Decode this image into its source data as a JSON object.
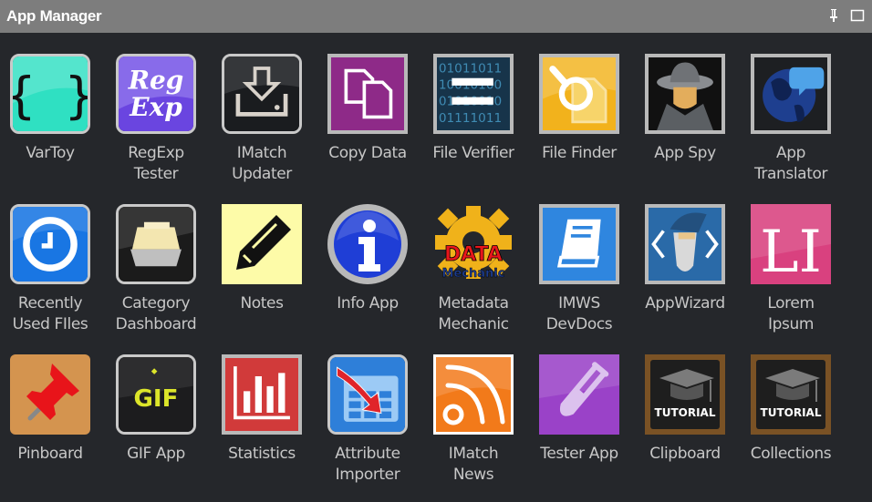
{
  "window": {
    "title": "App Manager",
    "pin_icon": "pin-icon",
    "maximize_icon": "maximize-icon"
  },
  "apps": [
    {
      "name": "VarToy",
      "lines": [
        "VarToy"
      ],
      "icon": "curly-braces-icon",
      "color": "#2fe0c2"
    },
    {
      "name": "RegExp Tester",
      "lines": [
        "RegExp",
        "Tester"
      ],
      "icon": "regexp-icon",
      "color": "#6a45e0",
      "icon_text": [
        "Reg",
        "Exp"
      ]
    },
    {
      "name": "IMatch Updater",
      "lines": [
        "IMatch",
        "Updater"
      ],
      "icon": "download-tray-icon",
      "color": "#1a1c1f"
    },
    {
      "name": "Copy Data",
      "lines": [
        "Copy Data"
      ],
      "icon": "copy-documents-icon",
      "color": "#8e2a88"
    },
    {
      "name": "File Verifier",
      "lines": [
        "File Verifier"
      ],
      "icon": "binary-equals-icon",
      "color": "#17344a",
      "icon_text": [
        "01011011",
        "10010100",
        "01010010",
        "01111011"
      ]
    },
    {
      "name": "File Finder",
      "lines": [
        "File Finder"
      ],
      "icon": "magnifier-file-icon",
      "color": "#f2b21c"
    },
    {
      "name": "App Spy",
      "lines": [
        "App Spy"
      ],
      "icon": "spy-icon",
      "color": "#111111"
    },
    {
      "name": "App Translator",
      "lines": [
        "App",
        "Translator"
      ],
      "icon": "globe-speech-icon",
      "color": "#1e3f8f"
    },
    {
      "name": "Recently Used FIles",
      "lines": [
        "Recently",
        "Used FIles"
      ],
      "icon": "clock-icon",
      "color": "#1976e3"
    },
    {
      "name": "Category Dashboard",
      "lines": [
        "Category",
        "Dashboard"
      ],
      "icon": "card-file-icon",
      "color": "#1b1b1b"
    },
    {
      "name": "Notes",
      "lines": [
        "Notes"
      ],
      "icon": "pencil-icon",
      "color": "#fdfba8"
    },
    {
      "name": "Info App",
      "lines": [
        "Info App"
      ],
      "icon": "info-icon",
      "color": "#1f3ed6"
    },
    {
      "name": "Metadata Mechanic",
      "lines": [
        "Metadata",
        "Mechanic"
      ],
      "icon": "gear-data-icon",
      "color": "#f0b21a",
      "icon_text": [
        "DATA",
        "Mechanic"
      ]
    },
    {
      "name": "IMWS DevDocs",
      "lines": [
        "IMWS",
        "DevDocs"
      ],
      "icon": "book-icon",
      "color": "#2f86df"
    },
    {
      "name": "AppWizard",
      "lines": [
        "AppWizard"
      ],
      "icon": "wizard-icon",
      "color": "#2a6aa8"
    },
    {
      "name": "Lorem Ipsum",
      "lines": [
        "Lorem",
        "Ipsum"
      ],
      "icon": "lorem-ipsum-icon",
      "color": "#d9417f",
      "icon_text": [
        "LI"
      ]
    },
    {
      "name": "Pinboard",
      "lines": [
        "Pinboard"
      ],
      "icon": "pushpin-icon",
      "color": "#d4944f"
    },
    {
      "name": "GIF App",
      "lines": [
        "GIF App"
      ],
      "icon": "gif-icon",
      "color": "#1c1c1e",
      "icon_text": [
        "GIF"
      ]
    },
    {
      "name": "Statistics",
      "lines": [
        "Statistics"
      ],
      "icon": "bar-chart-icon",
      "color": "#d13a3a"
    },
    {
      "name": "Attribute Importer",
      "lines": [
        "Attribute",
        "Importer"
      ],
      "icon": "table-import-icon",
      "color": "#2e7fd9"
    },
    {
      "name": "IMatch News",
      "lines": [
        "IMatch",
        "News"
      ],
      "icon": "rss-icon",
      "color": "#f27a1a"
    },
    {
      "name": "Tester App",
      "lines": [
        "Tester App"
      ],
      "icon": "test-tube-icon",
      "color": "#9a42c8"
    },
    {
      "name": "Clipboard",
      "lines": [
        "Clipboard"
      ],
      "icon": "tutorial-cap-icon",
      "color": "#7a5225",
      "icon_text": [
        "TUTORIAL"
      ]
    },
    {
      "name": "Collections",
      "lines": [
        "Collections"
      ],
      "icon": "tutorial-cap-icon",
      "color": "#7a5225",
      "icon_text": [
        "TUTORIAL"
      ]
    }
  ]
}
